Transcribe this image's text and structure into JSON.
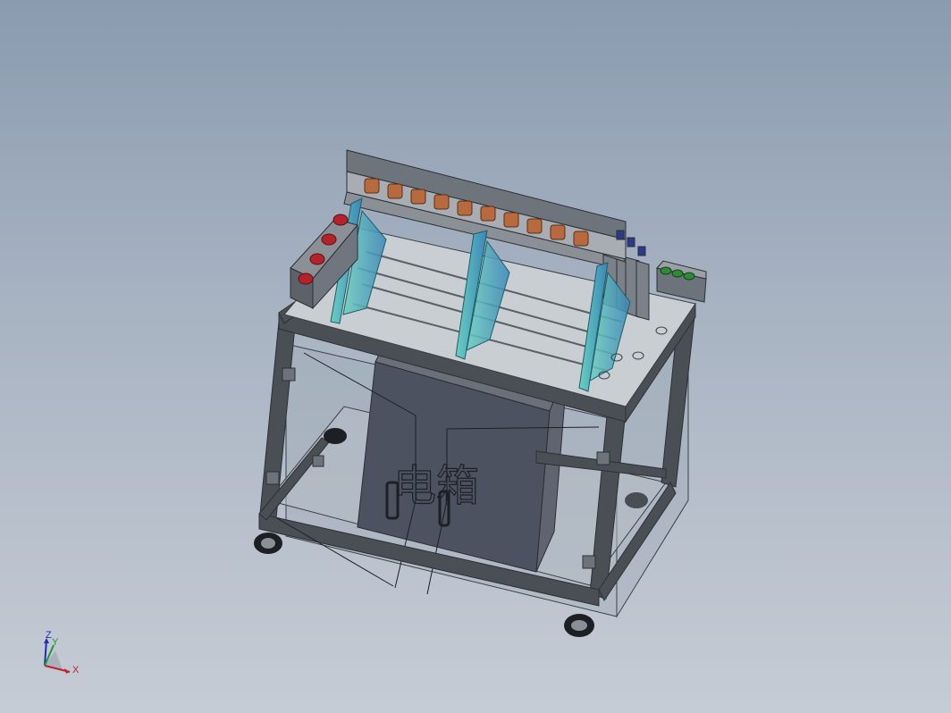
{
  "viewport": {
    "background_top": "#8a9bb0",
    "background_bottom": "#c6ccd5"
  },
  "model": {
    "cabinet_text": "电箱",
    "colors": {
      "frame": "#4a4f55",
      "frame_edge": "#2c3035",
      "cabinet": "#4d5260",
      "cabinet_side": "#5f6470",
      "plate": "#c9ced3",
      "rail": "#8b9096",
      "guide": "#5fb8c0",
      "guide_dark": "#3c8f9c",
      "red_button": "#b4232a",
      "green_button": "#2f8a34",
      "copper": "#b86a3f",
      "glass": "#9aa6b3"
    }
  },
  "triad": {
    "x_label": "X",
    "y_label": "Y",
    "z_label": "Z",
    "x_color": "#c0222a",
    "y_color": "#1e9a2d",
    "z_color": "#1d2fb5"
  }
}
